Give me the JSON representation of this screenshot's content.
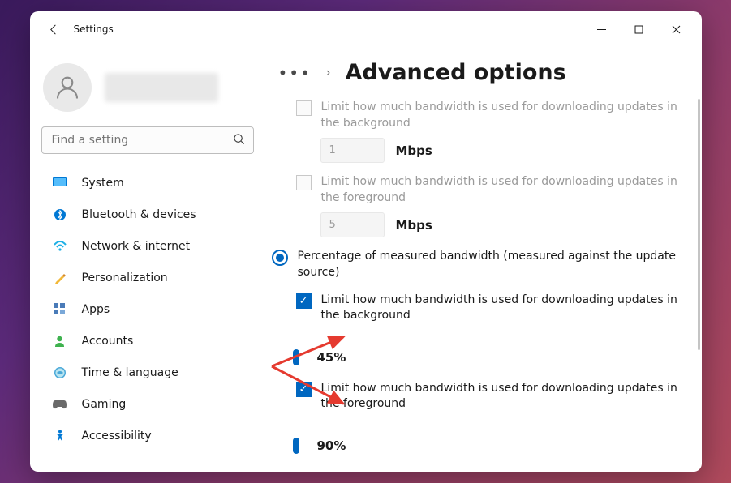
{
  "window": {
    "app_title": "Settings"
  },
  "search": {
    "placeholder": "Find a setting"
  },
  "nav": {
    "system": "System",
    "bluetooth": "Bluetooth & devices",
    "network": "Network & internet",
    "personalization": "Personalization",
    "apps": "Apps",
    "accounts": "Accounts",
    "time": "Time & language",
    "gaming": "Gaming",
    "accessibility": "Accessibility"
  },
  "breadcrumb": {
    "page_title": "Advanced options"
  },
  "settings": {
    "bg_abs": {
      "label": "Limit how much bandwidth is used for downloading updates in the background",
      "value": "1",
      "unit": "Mbps"
    },
    "fg_abs": {
      "label": "Limit how much bandwidth is used for downloading updates in the foreground",
      "value": "5",
      "unit": "Mbps"
    },
    "pct_radio": {
      "label": "Percentage of measured bandwidth (measured against the update source)"
    },
    "bg_pct": {
      "label": "Limit how much bandwidth is used for downloading updates in the background",
      "value": 45,
      "display": "45%"
    },
    "fg_pct": {
      "label": "Limit how much bandwidth is used for downloading updates in the foreground",
      "value": 90,
      "display": "90%"
    }
  }
}
